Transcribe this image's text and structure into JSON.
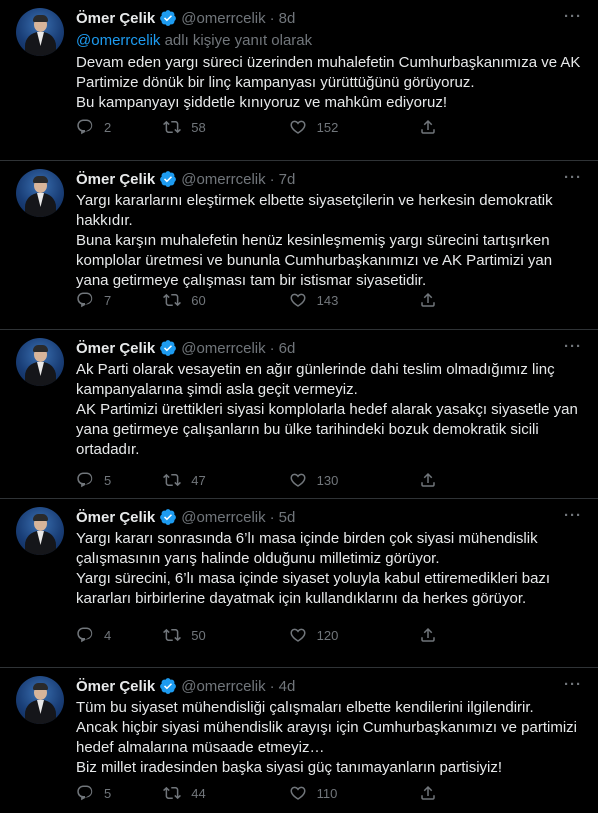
{
  "author": {
    "name": "Ömer Çelik",
    "handle": "@omerrcelik",
    "verified_icon": "verified-badge-icon",
    "accent": "#1d9bf0"
  },
  "tweets": [
    {
      "time": "8d",
      "reply_to": {
        "mention": "@omerrcelik",
        "suffix": "adlı kişiye yanıt olarak"
      },
      "paragraphs": [
        "Devam eden yargı süreci üzerinden muhalefetin Cumhurbaşkanımıza ve AK Partimize dönük bir linç kampanyası yürüttüğünü görüyoruz.",
        "Bu kampanyayı şiddetle kınıyoruz ve mahkûm ediyoruz!"
      ],
      "replies": "2",
      "retweets": "58",
      "likes": "152"
    },
    {
      "time": "7d",
      "paragraphs": [
        "Yargı kararlarını eleştirmek elbette siyasetçilerin ve herkesin demokratik hakkıdır.",
        "Buna karşın muhalefetin henüz kesinleşmemiş yargı sürecini tartışırken komplolar üretmesi ve bununla Cumhurbaşkanımızı ve AK Partimizi yan yana getirmeye çalışması tam bir istismar siyasetidir."
      ],
      "replies": "7",
      "retweets": "60",
      "likes": "143"
    },
    {
      "time": "6d",
      "paragraphs": [
        "Ak Parti olarak vesayetin en ağır günlerinde dahi teslim olmadığımız linç kampanyalarına şimdi asla geçit vermeyiz.",
        "AK Partimizi ürettikleri siyasi komplolarla hedef alarak yasakçı siyasetle yan yana getirmeye çalışanların bu ülke tarihindeki bozuk demokratik sicili ortadadır."
      ],
      "replies": "5",
      "retweets": "47",
      "likes": "130"
    },
    {
      "time": "5d",
      "paragraphs": [
        "Yargı kararı sonrasında 6’lı masa içinde birden çok siyasi mühendislik çalışmasının yarış halinde olduğunu milletimiz görüyor.",
        "Yargı sürecini, 6’lı masa içinde siyaset yoluyla kabul ettiremedikleri bazı kararları birbirlerine dayatmak için kullandıklarını da herkes görüyor."
      ],
      "replies": "4",
      "retweets": "50",
      "likes": "120"
    },
    {
      "time": "4d",
      "paragraphs": [
        "Tüm bu siyaset mühendisliği çalışmaları elbette kendilerini ilgilendirir.",
        "Ancak hiçbir siyasi mühendislik arayışı için Cumhurbaşkanımızı ve partimizi hedef almalarına müsaade etmeyiz…",
        "Biz millet iradesinden başka siyasi güç tanımayanların partisiyiz!"
      ],
      "replies": "5",
      "retweets": "44",
      "likes": "110"
    }
  ],
  "icons": {
    "more": "more-options-icon",
    "reply": "reply-icon",
    "retweet": "retweet-icon",
    "like": "heart-icon",
    "share": "share-icon"
  }
}
